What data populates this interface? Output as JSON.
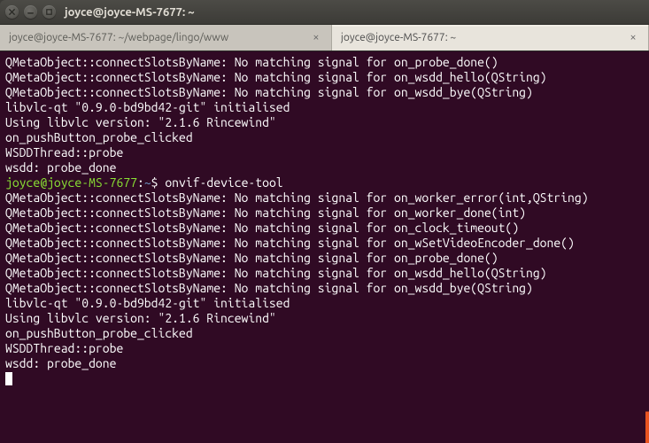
{
  "window": {
    "title": "joyce@joyce-MS-7677: ~"
  },
  "tabs": [
    {
      "label": "joyce@joyce-MS-7677: ~/webpage/lingo/www",
      "active": false
    },
    {
      "label": "joyce@joyce-MS-7677: ~",
      "active": true
    }
  ],
  "prompt": {
    "user_host": "joyce@joyce-MS-7677",
    "path": "~",
    "symbol": "$"
  },
  "terminal_lines": [
    "QMetaObject::connectSlotsByName: No matching signal for on_probe_done()",
    "QMetaObject::connectSlotsByName: No matching signal for on_wsdd_hello(QString)",
    "QMetaObject::connectSlotsByName: No matching signal for on_wsdd_bye(QString)",
    "libvlc-qt \"0.9.0-bd9bd42-git\" initialised",
    "Using libvlc version: \"2.1.6 Rincewind\"",
    "on_pushButton_probe_clicked",
    "WSDDThread::probe",
    "wsdd: probe_done",
    {
      "type": "prompt",
      "command": "onvif-device-tool"
    },
    "QMetaObject::connectSlotsByName: No matching signal for on_worker_error(int,QString)",
    "QMetaObject::connectSlotsByName: No matching signal for on_worker_done(int)",
    "QMetaObject::connectSlotsByName: No matching signal for on_clock_timeout()",
    "QMetaObject::connectSlotsByName: No matching signal for on_wSetVideoEncoder_done()",
    "QMetaObject::connectSlotsByName: No matching signal for on_probe_done()",
    "QMetaObject::connectSlotsByName: No matching signal for on_wsdd_hello(QString)",
    "QMetaObject::connectSlotsByName: No matching signal for on_wsdd_bye(QString)",
    "libvlc-qt \"0.9.0-bd9bd42-git\" initialised",
    "Using libvlc version: \"2.1.6 Rincewind\"",
    "on_pushButton_probe_clicked",
    "WSDDThread::probe",
    "wsdd: probe_done"
  ]
}
